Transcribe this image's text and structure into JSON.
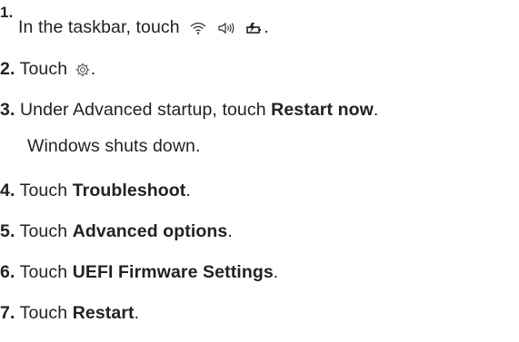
{
  "steps": [
    {
      "number": "1.",
      "text_before": "In the taskbar, touch",
      "icons": [
        "wifi-icon",
        "speaker-icon",
        "battery-icon"
      ],
      "text_after": "."
    },
    {
      "number": "2.",
      "text_before": "Touch",
      "icons": [
        "gear-icon"
      ],
      "text_after": "."
    },
    {
      "number": "3.",
      "text_before": "Under Advanced startup, touch ",
      "bold": "Restart now",
      "text_after": ".",
      "result": "Windows shuts down."
    },
    {
      "number": "4.",
      "text_before": "Touch ",
      "bold": "Troubleshoot",
      "text_after": "."
    },
    {
      "number": "5.",
      "text_before": "Touch ",
      "bold": "Advanced options",
      "text_after": "."
    },
    {
      "number": "6.",
      "text_before": "Touch ",
      "bold": "UEFI Firmware Settings",
      "text_after": "."
    },
    {
      "number": "7.",
      "text_before": "Touch ",
      "bold": "Restart",
      "text_after": "."
    }
  ]
}
